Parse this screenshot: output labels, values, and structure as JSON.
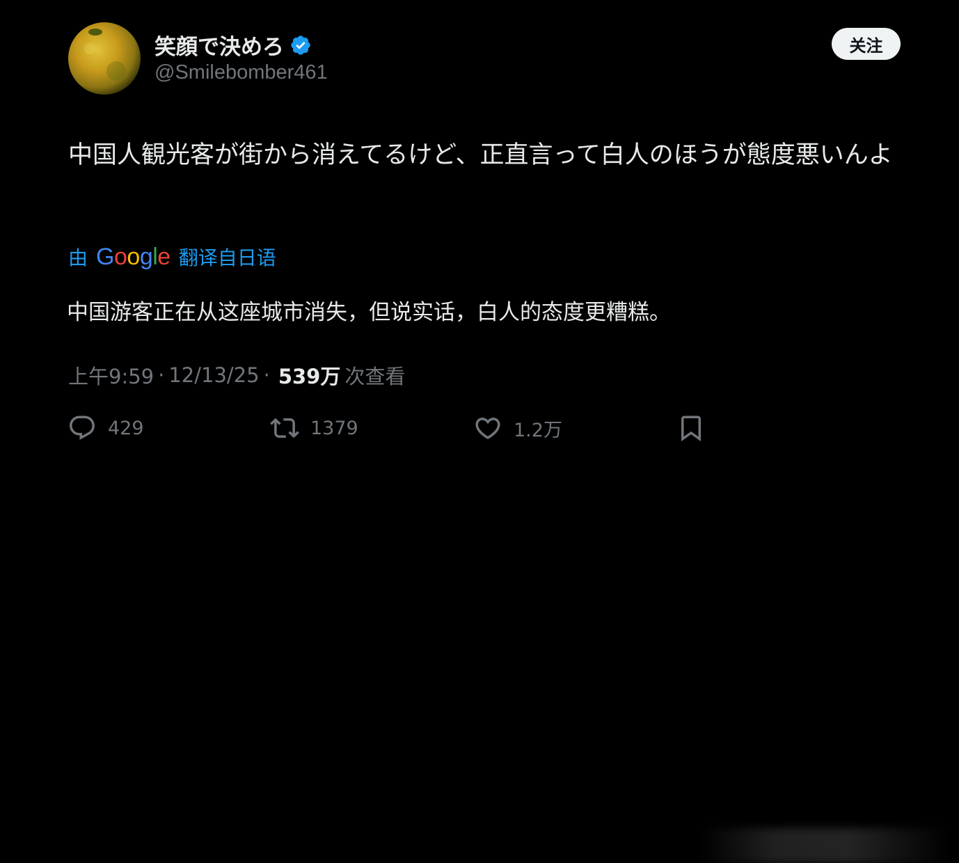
{
  "author": {
    "name": "笑顔で決めろ",
    "handle": "@Smilebomber461",
    "verified": true,
    "avatar_icon": "orange-fruit-avatar"
  },
  "follow_label": "关注",
  "tweet": {
    "text": "中国人観光客が街から消えてるけど、正直言って白人のほうが態度悪いんよ"
  },
  "translation": {
    "prefix": "由",
    "provider": "Google",
    "suffix": "翻译自日语",
    "text": "中国游客正在从这座城市消失，但说实话，白人的态度更糟糕。"
  },
  "meta": {
    "time": "上午9:59",
    "date": "12/13/25",
    "views": "539万",
    "views_label": "次查看"
  },
  "actions": {
    "reply_count": "429",
    "repost_count": "1379",
    "like_count": "1.2万"
  },
  "colors": {
    "accent": "#1d9bf0",
    "muted": "#71767b",
    "text": "#e7e9ea",
    "background": "#000000"
  }
}
